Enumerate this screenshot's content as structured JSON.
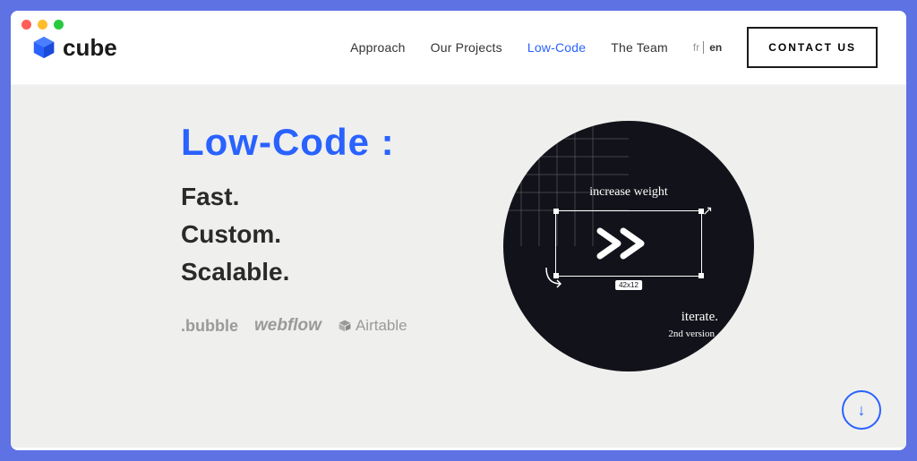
{
  "logo": {
    "text": "cube"
  },
  "nav": {
    "items": [
      {
        "label": "Approach",
        "active": false
      },
      {
        "label": "Our Projects",
        "active": false
      },
      {
        "label": "Low-Code",
        "active": true
      },
      {
        "label": "The Team",
        "active": false
      }
    ]
  },
  "lang": {
    "fr": "fr",
    "en": "en"
  },
  "contact": {
    "label": "CONTACT US"
  },
  "hero": {
    "title": "Low-Code :",
    "line1": "Fast.",
    "line2": "Custom.",
    "line3": "Scalable."
  },
  "tools": {
    "bubble": ".bubble",
    "webflow": "webflow",
    "airtable": "Airtable"
  },
  "illus": {
    "annotation_top": "increase weight",
    "annotation_iterate": "iterate.",
    "annotation_version": "2nd version",
    "dimensions": "42x12"
  },
  "colors": {
    "accent": "#2962ff",
    "frame": "#5e72e4",
    "dark": "#12121a"
  }
}
